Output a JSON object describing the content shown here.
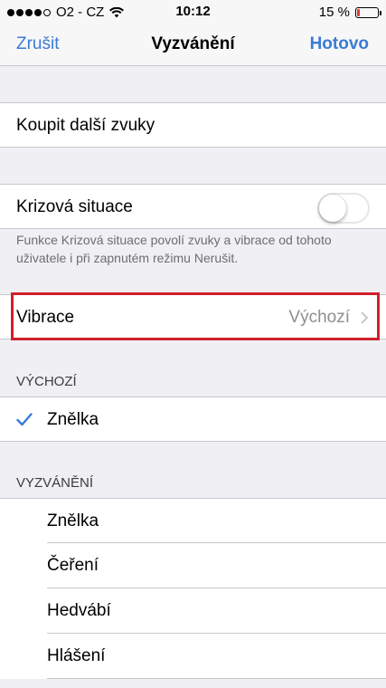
{
  "status_bar": {
    "carrier": "O2 - CZ",
    "time": "10:12",
    "battery_text": "15 %",
    "battery_level": 0.15,
    "battery_color": "#e53935",
    "signal_dots_filled": 4,
    "signal_dots_total": 5
  },
  "nav": {
    "left_label": "Zrušit",
    "title": "Vyzvánění",
    "right_label": "Hotovo",
    "accent_color": "#3a7bd5"
  },
  "store": {
    "label": "Koupit další zvuky"
  },
  "emergency": {
    "label": "Krizová situace",
    "toggle_on": false,
    "footer": "Funkce Krizová situace povolí zvuky a vibrace od tohoto uživatele i při zapnutém režimu Nerušit."
  },
  "vibration": {
    "label": "Vibrace",
    "value": "Výchozí",
    "highlight_color": "#d0202a"
  },
  "default_section": {
    "header": "VÝCHOZÍ",
    "items": [
      {
        "label": "Znělka",
        "checked": true
      }
    ]
  },
  "ringtones_section": {
    "header": "VYZVÁNĚNÍ",
    "items": [
      {
        "label": "Znělka"
      },
      {
        "label": "Čeření"
      },
      {
        "label": "Hedvábí"
      },
      {
        "label": "Hlášení"
      }
    ]
  },
  "icons": {
    "signal": "signal-dots-icon",
    "wifi": "wifi-icon",
    "battery": "battery-icon",
    "chevron": "chevron-right-icon",
    "check": "checkmark-icon"
  }
}
